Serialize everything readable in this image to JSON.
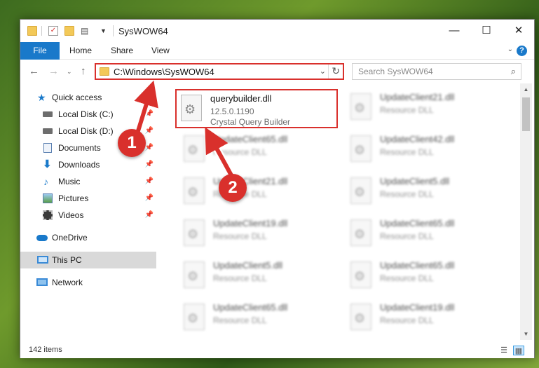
{
  "window": {
    "title": "SysWOW64"
  },
  "ribbon": {
    "file": "File",
    "home": "Home",
    "share": "Share",
    "view": "View"
  },
  "nav": {
    "address": "C:\\Windows\\SysWOW64",
    "search_placeholder": "Search SysWOW64"
  },
  "sidebar": {
    "items": [
      {
        "label": "Quick access"
      },
      {
        "label": "Local Disk (C:)"
      },
      {
        "label": "Local Disk (D:)"
      },
      {
        "label": "Documents"
      },
      {
        "label": "Downloads"
      },
      {
        "label": "Music"
      },
      {
        "label": "Pictures"
      },
      {
        "label": "Videos"
      },
      {
        "label": "OneDrive"
      },
      {
        "label": "This PC"
      },
      {
        "label": "Network"
      }
    ]
  },
  "files": [
    {
      "name": "querybuilder.dll",
      "line2": "12.5.0.1190",
      "line3": "Crystal Query Builder"
    },
    {
      "name": "UpdateClient21.dll",
      "line2": "Resource DLL"
    },
    {
      "name": "UpdateClient65.dll",
      "line2": "Resource DLL"
    },
    {
      "name": "UpdateClient42.dll",
      "line2": "Resource DLL"
    },
    {
      "name": "UpdateClient21.dll",
      "line2": "Resource DLL"
    },
    {
      "name": "UpdateClient5.dll",
      "line2": "Resource DLL"
    },
    {
      "name": "UpdateClient19.dll",
      "line2": "Resource DLL"
    },
    {
      "name": "UpdateClient65.dll",
      "line2": "Resource DLL"
    },
    {
      "name": "UpdateClient5.dll",
      "line2": "Resource DLL"
    },
    {
      "name": "UpdateClient65.dll",
      "line2": "Resource DLL"
    },
    {
      "name": "UpdateClient65.dll",
      "line2": "Resource DLL"
    },
    {
      "name": "UpdateClient19.dll",
      "line2": "Resource DLL"
    }
  ],
  "status": {
    "items_count": "142 items"
  },
  "annotations": {
    "step1": "1",
    "step2": "2"
  },
  "colors": {
    "accent": "#1979ca",
    "highlight": "#d9302c",
    "selection": "#cce8ff"
  }
}
